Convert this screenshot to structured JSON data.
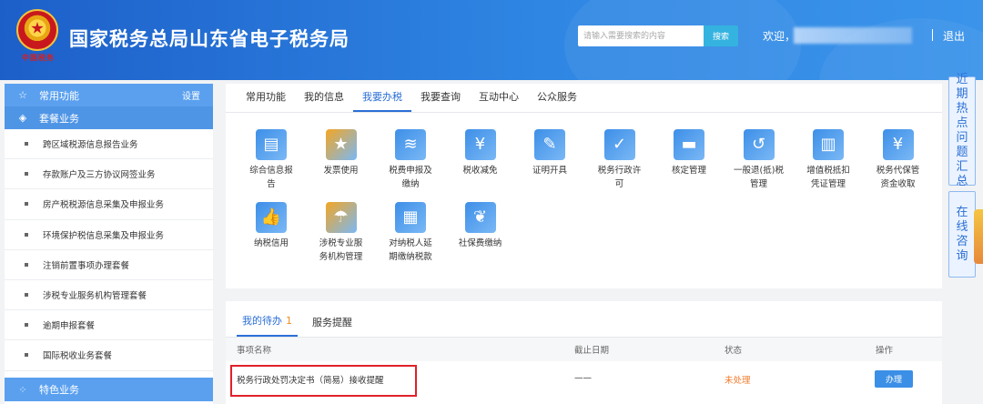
{
  "header": {
    "emblem_text": "中国税务",
    "title": "国家税务总局山东省电子税务局",
    "search_placeholder": "请输入需要搜索的内容",
    "search_button": "搜索",
    "welcome": "欢迎，",
    "logout": "退出"
  },
  "sidebar": {
    "common": {
      "label": "常用功能",
      "setting": "设置",
      "icon": "star-icon"
    },
    "package": {
      "label": "套餐业务",
      "icon": "layers-icon"
    },
    "items": [
      "跨区域税源信息报告业务",
      "存款账户及三方协议网签业务",
      "房产税税源信息采集及申报业务",
      "环境保护税信息采集及申报业务",
      "注销前置事项办理套餐",
      "涉税专业服务机构管理套餐",
      "逾期申报套餐",
      "国际税收业务套餐"
    ],
    "special": {
      "label": "特色业务",
      "icon": "grid-icon"
    }
  },
  "main_tabs": [
    "常用功能",
    "我的信息",
    "我要办税",
    "我要查询",
    "互动中心",
    "公众服务"
  ],
  "active_tab_index": 2,
  "tiles": [
    {
      "l1": "综合信息报",
      "l2": "告",
      "color": "#3d8fe8",
      "icon": "document-icon"
    },
    {
      "l1": "发票使用",
      "l2": "",
      "color": "#f3a623",
      "icon": "invoice-icon"
    },
    {
      "l1": "税费申报及",
      "l2": "缴纳",
      "color": "#3d8fe8",
      "icon": "stack-icon"
    },
    {
      "l1": "税收减免",
      "l2": "",
      "color": "#3d8fe8",
      "icon": "yuan-minus-icon"
    },
    {
      "l1": "证明开具",
      "l2": "",
      "color": "#3d8fe8",
      "icon": "pen-icon"
    },
    {
      "l1": "税务行政许",
      "l2": "可",
      "color": "#3d8fe8",
      "icon": "permit-icon"
    },
    {
      "l1": "核定管理",
      "l2": "",
      "color": "#3d8fe8",
      "icon": "folder-icon"
    },
    {
      "l1": "一般退(抵)税",
      "l2": "管理",
      "color": "#3d8fe8",
      "icon": "refund-icon"
    },
    {
      "l1": "增值税抵扣",
      "l2": "凭证管理",
      "color": "#3d8fe8",
      "icon": "voucher-icon"
    },
    {
      "l1": "税务代保管",
      "l2": "资金收取",
      "color": "#3d8fe8",
      "icon": "custody-icon"
    },
    {
      "l1": "纳税信用",
      "l2": "",
      "color": "#3d8fe8",
      "icon": "thumbs-up-icon"
    },
    {
      "l1": "涉税专业服",
      "l2": "务机构管理",
      "color": "#f3a623",
      "icon": "umbrella-icon"
    },
    {
      "l1": "对纳税人延",
      "l2": "期缴纳税款",
      "color": "#3d8fe8",
      "icon": "apps-icon"
    },
    {
      "l1": "社保费缴纳",
      "l2": "",
      "color": "#3d8fe8",
      "icon": "hands-icon"
    }
  ],
  "todo": {
    "tab1": "我的待办",
    "tab1_count": "1",
    "tab2": "服务提醒",
    "columns": [
      "事项名称",
      "截止日期",
      "状态",
      "操作"
    ],
    "rows": [
      {
        "name": "税务行政处罚决定书（简易）接收提醒",
        "deadline": "——",
        "status": "未处理",
        "action": "办理"
      }
    ]
  },
  "floating": {
    "hot": [
      "近",
      "期",
      "热",
      "点",
      "问",
      "题",
      "汇",
      "总"
    ],
    "consult": [
      "在",
      "线",
      "咨",
      "询"
    ]
  }
}
